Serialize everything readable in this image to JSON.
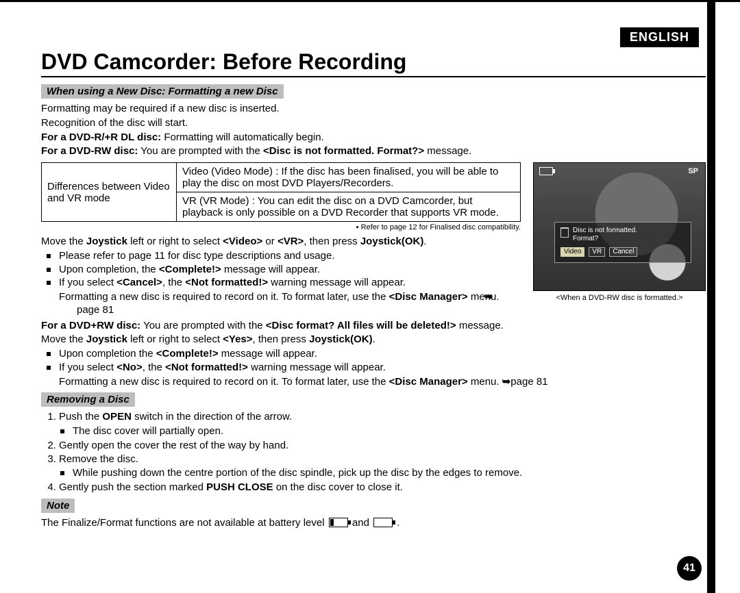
{
  "language_badge": "ENGLISH",
  "page_number": "41",
  "title": "DVD Camcorder: Before Recording",
  "section1": {
    "label": "When using a New Disc: Formatting a new Disc",
    "p1": "Formatting may be required if a new disc is inserted.",
    "p2": "Recognition of the disc will start.",
    "p3_label": "For a DVD-R/+R DL disc:",
    "p3_rest": " Formatting will automatically begin.",
    "p4_label": "For a DVD-RW disc:",
    "p4_rest": " You are prompted with the ",
    "p4_msg": "<Disc is not formatted. Format?>",
    "p4_tail": " message."
  },
  "diff_table": {
    "head": "Differences between Video and VR mode",
    "row1": "Video (Video Mode) : If the disc has been finalised, you will be able to play the disc on most DVD Players/Recorders.",
    "row2": "VR (VR Mode) : You can edit the disc on a DVD Camcorder, but playback is only possible on a DVD Recorder that supports VR mode.",
    "caption_bullet": "▪",
    "caption": "Refer to page 12 for Finalised disc compatibility."
  },
  "after_table": {
    "move1_a": "Move the ",
    "move1_joy": "Joystick",
    "move1_b": " left or right to select ",
    "move1_video": "<Video>",
    "move1_or": " or ",
    "move1_vr": "<VR>",
    "move1_c": ", then press ",
    "move1_ok": "Joystick(OK)",
    "move1_d": ".",
    "b1": "Please refer to page 11 for disc type descriptions and usage.",
    "b2_a": "Upon completion, the ",
    "b2_msg": "<Complete!>",
    "b2_b": " message will appear.",
    "b3_a": "If you select ",
    "b3_cancel": "<Cancel>",
    "b3_b": ", the ",
    "b3_nf": "<Not formatted!>",
    "b3_c": " warning message will appear.",
    "p_format_a": "Formatting a new disc is required to record on it. To format later, use the ",
    "p_format_dm": "<Disc Manager>",
    "p_format_b": " menu. ",
    "p_format_arrow": "➥",
    "p_format_page": "page 81"
  },
  "dvd_plus_rw": {
    "label": "For a DVD+RW disc:",
    "rest_a": " You are prompted with the ",
    "msg": "<Disc format? All files will be deleted!>",
    "rest_b": " message.",
    "move_a": "Move the ",
    "move_joy": "Joystick",
    "move_b": " left or right to select ",
    "move_yes": "<Yes>",
    "move_c": ", then press ",
    "move_ok": "Joystick(OK)",
    "move_d": ".",
    "b1_a": "Upon completion the ",
    "b1_msg": "<Complete!>",
    "b1_b": " message will appear.",
    "b2_a": "If you select ",
    "b2_no": "<No>",
    "b2_b": ", the ",
    "b2_nf": "<Not formatted!>",
    "b2_c": " warning message will appear.",
    "p_format_a": "Formatting a new disc is required to record on it. To format later, use the ",
    "p_format_dm": "<Disc Manager>",
    "p_format_b": " menu. ",
    "p_format_arrow": "➥",
    "p_format_page": "page 81"
  },
  "section2": {
    "label": "Removing a Disc",
    "s1_a": "Push the ",
    "s1_open": "OPEN",
    "s1_b": " switch in the direction of the arrow.",
    "s1_sub": "The disc cover will partially open.",
    "s2": "Gently open the cover the rest of the way by hand.",
    "s3": "Remove the disc.",
    "s3_sub": "While pushing down the centre portion of the disc spindle, pick up the disc by the edges to remove.",
    "s4_a": "Gently push the section marked ",
    "s4_push": "PUSH CLOSE",
    "s4_b": " on the disc cover to close it."
  },
  "note": {
    "label": "Note",
    "text_a": "The Finalize/Format functions are not available at battery level ",
    "text_and": " and ",
    "text_end": "."
  },
  "cam": {
    "sp": "SP",
    "line1": "Disc is not formatted.",
    "line2": "Format?",
    "btn_video": "Video",
    "btn_vr": "VR",
    "btn_cancel": "Cancel",
    "caption": "<When a DVD-RW disc is formatted.>"
  }
}
